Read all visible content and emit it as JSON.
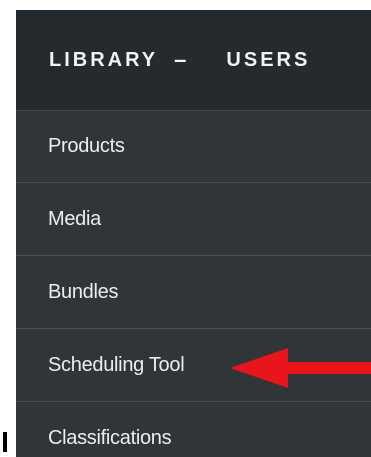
{
  "header": {
    "tabs": [
      {
        "label": "LIBRARY"
      },
      {
        "label": "USERS"
      }
    ],
    "library_expand_symbol": "–"
  },
  "menu": {
    "items": [
      {
        "label": "Products"
      },
      {
        "label": "Media"
      },
      {
        "label": "Bundles"
      },
      {
        "label": "Scheduling Tool"
      },
      {
        "label": "Classifications"
      }
    ]
  },
  "annotation": {
    "arrow_color": "#e8161b",
    "points_to": "Scheduling Tool"
  },
  "colors": {
    "panel_background": "#2f3538",
    "header_background": "#242a2d",
    "text": "#e9eef0",
    "divider": "#465054"
  }
}
